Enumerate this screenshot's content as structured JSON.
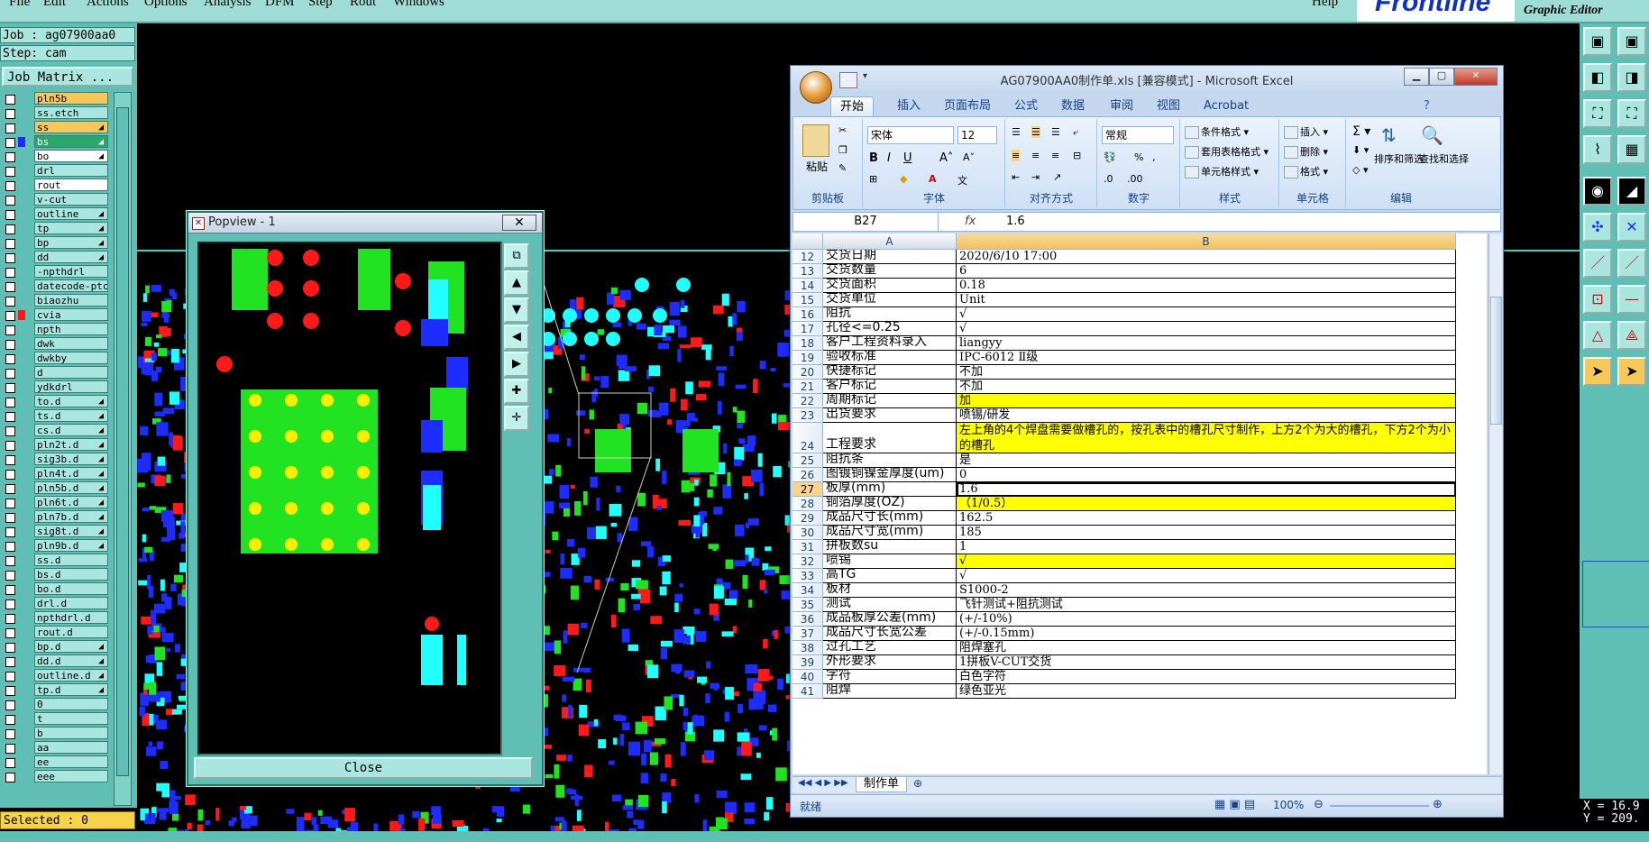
{
  "menubar": {
    "items": [
      "File",
      "Edit",
      "Actions",
      "Options",
      "Analysis",
      "DFM",
      "Step",
      "Rout",
      "Windows"
    ],
    "help": "Help",
    "logo": "Frontline",
    "product": "Graphic Editor"
  },
  "job": {
    "job_label": "Job : ag07900aa0",
    "step_label": "Step: cam",
    "matrix_button": "Job Matrix ..."
  },
  "layers": [
    {
      "name": "pln5b",
      "color": "#f6c85a",
      "flag": ""
    },
    {
      "name": "ss.etch",
      "color": "#a8e6df",
      "flag": ""
    },
    {
      "name": "ss",
      "color": "#f6c85a",
      "flag": "◢"
    },
    {
      "name": "bs",
      "color": "#2aa86c",
      "flag": "◢"
    },
    {
      "name": "bo",
      "color": "#ffffff",
      "flag": "◢"
    },
    {
      "name": "drl",
      "color": "#a8e6df",
      "flag": ""
    },
    {
      "name": "rout",
      "color": "#ffffff",
      "flag": ""
    },
    {
      "name": "v-cut",
      "color": "#a8e6df",
      "flag": ""
    },
    {
      "name": "outline",
      "color": "#a8e6df",
      "flag": "◢"
    },
    {
      "name": "tp",
      "color": "#a8e6df",
      "flag": "◢"
    },
    {
      "name": "bp",
      "color": "#a8e6df",
      "flag": "◢"
    },
    {
      "name": "dd",
      "color": "#a8e6df",
      "flag": "◢"
    },
    {
      "name": "-npthdrl",
      "color": "#a8e6df",
      "flag": ""
    },
    {
      "name": "datecode-ptc",
      "color": "#a8e6df",
      "flag": ""
    },
    {
      "name": "biaozhu",
      "color": "#a8e6df",
      "flag": ""
    },
    {
      "name": "cvia",
      "color": "#a8e6df",
      "flag": ""
    },
    {
      "name": "npth",
      "color": "#a8e6df",
      "flag": ""
    },
    {
      "name": "dwk",
      "color": "#a8e6df",
      "flag": ""
    },
    {
      "name": "dwkby",
      "color": "#a8e6df",
      "flag": ""
    },
    {
      "name": "d",
      "color": "#a8e6df",
      "flag": ""
    },
    {
      "name": "ydkdrl",
      "color": "#a8e6df",
      "flag": ""
    },
    {
      "name": "to.d",
      "color": "#a8e6df",
      "flag": "◢"
    },
    {
      "name": "ts.d",
      "color": "#a8e6df",
      "flag": "◢"
    },
    {
      "name": "cs.d",
      "color": "#a8e6df",
      "flag": "◢"
    },
    {
      "name": "pln2t.d",
      "color": "#a8e6df",
      "flag": "◢"
    },
    {
      "name": "sig3b.d",
      "color": "#a8e6df",
      "flag": "◢"
    },
    {
      "name": "pln4t.d",
      "color": "#a8e6df",
      "flag": "◢"
    },
    {
      "name": "pln5b.d",
      "color": "#a8e6df",
      "flag": "◢"
    },
    {
      "name": "pln6t.d",
      "color": "#a8e6df",
      "flag": "◢"
    },
    {
      "name": "pln7b.d",
      "color": "#a8e6df",
      "flag": "◢"
    },
    {
      "name": "sig8t.d",
      "color": "#a8e6df",
      "flag": "◢"
    },
    {
      "name": "pln9b.d",
      "color": "#a8e6df",
      "flag": "◢"
    },
    {
      "name": "ss.d",
      "color": "#a8e6df",
      "flag": ""
    },
    {
      "name": "bs.d",
      "color": "#a8e6df",
      "flag": ""
    },
    {
      "name": "bo.d",
      "color": "#a8e6df",
      "flag": ""
    },
    {
      "name": "drl.d",
      "color": "#a8e6df",
      "flag": ""
    },
    {
      "name": "npthdrl.d",
      "color": "#a8e6df",
      "flag": ""
    },
    {
      "name": "rout.d",
      "color": "#a8e6df",
      "flag": ""
    },
    {
      "name": "bp.d",
      "color": "#a8e6df",
      "flag": "◢"
    },
    {
      "name": "dd.d",
      "color": "#a8e6df",
      "flag": "◢"
    },
    {
      "name": "outline.d",
      "color": "#a8e6df",
      "flag": "◢"
    },
    {
      "name": "tp.d",
      "color": "#a8e6df",
      "flag": "◢"
    },
    {
      "name": "0",
      "color": "#a8e6df",
      "flag": ""
    },
    {
      "name": "t",
      "color": "#a8e6df",
      "flag": ""
    },
    {
      "name": "b",
      "color": "#a8e6df",
      "flag": ""
    },
    {
      "name": "aa",
      "color": "#a8e6df",
      "flag": ""
    },
    {
      "name": "ee",
      "color": "#a8e6df",
      "flag": ""
    },
    {
      "name": "eee",
      "color": "#a8e6df",
      "flag": ""
    }
  ],
  "selected_label": "Selected : 0",
  "popview": {
    "title": "Popview - 1",
    "close_x": "✕",
    "close_button": "Close"
  },
  "excel": {
    "title": "AG07900AA0制作单.xls  [兼容模式] - Microsoft Excel",
    "tabs": [
      "开始",
      "插入",
      "页面布局",
      "公式",
      "数据",
      "审阅",
      "视图",
      "Acrobat"
    ],
    "ribbon": {
      "paste": "粘贴",
      "clipboard": "剪贴板",
      "font_name": "宋体",
      "font_size": "12",
      "font_group": "字体",
      "align_group": "对齐方式",
      "number_format": "常规",
      "number_group": "数字",
      "cond_format": "条件格式",
      "table_format": "套用表格格式",
      "cell_style": "单元格样式",
      "style_group": "样式",
      "insert": "插入",
      "delete": "删除",
      "format": "格式",
      "cells_group": "单元格",
      "sort_filter": "排序和筛选",
      "find_select": "查找和选择",
      "edit_group": "编辑"
    },
    "name_box": "B27",
    "fx": "fx",
    "formula_value": "1.6",
    "col_a": "A",
    "col_b": "B",
    "rows": [
      {
        "n": "12",
        "a": "交货日期",
        "b": "2020/6/10 17:00",
        "hl": false,
        "h": 16
      },
      {
        "n": "13",
        "a": "交货数量",
        "b": "6",
        "hl": false,
        "h": 16
      },
      {
        "n": "14",
        "a": "交货面积",
        "b": "0.18",
        "hl": false,
        "h": 16
      },
      {
        "n": "15",
        "a": "交货单位",
        "b": "Unit",
        "hl": false,
        "h": 16
      },
      {
        "n": "16",
        "a": "阻抗",
        "b": "√",
        "hl": false,
        "h": 16
      },
      {
        "n": "17",
        "a": "孔径<=0.25",
        "b": "√",
        "hl": false,
        "h": 16
      },
      {
        "n": "18",
        "a": "客户工程资料录入",
        "b": "liangyy",
        "hl": false,
        "h": 16
      },
      {
        "n": "19",
        "a": "验收标准",
        "b": "IPC-6012 Ⅱ级",
        "hl": false,
        "h": 16
      },
      {
        "n": "20",
        "a": "快捷标记",
        "b": "不加",
        "hl": false,
        "h": 16
      },
      {
        "n": "21",
        "a": "客户标记",
        "b": "不加",
        "hl": false,
        "h": 16
      },
      {
        "n": "22",
        "a": "周期标记",
        "b": "加",
        "hl": true,
        "h": 16
      },
      {
        "n": "23",
        "a": "出货要求",
        "b": "喷锡/研发",
        "hl": false,
        "h": 16
      },
      {
        "n": "24",
        "a": "工程要求",
        "b": "左上角的4个焊盘需要做槽孔的，按孔表中的槽孔尺寸制作，上方2个为大的槽孔，下方2个为小的槽孔",
        "hl": true,
        "h": 34,
        "wrap": true
      },
      {
        "n": "25",
        "a": "阻抗条",
        "b": "是",
        "hl": false,
        "h": 16
      },
      {
        "n": "26",
        "a": "图镀铜镍金厚度(um)",
        "b": "0",
        "hl": false,
        "h": 16
      },
      {
        "n": "27",
        "a": "板厚(mm)",
        "b": "1.6",
        "hl": false,
        "h": 16,
        "active": true
      },
      {
        "n": "28",
        "a": "铜箔厚度(OZ)",
        "b": "（1/0.5）",
        "hl": true,
        "h": 16
      },
      {
        "n": "29",
        "a": "成品尺寸长(mm)",
        "b": "162.5",
        "hl": false,
        "h": 16
      },
      {
        "n": "30",
        "a": "成品尺寸宽(mm)",
        "b": "185",
        "hl": false,
        "h": 16
      },
      {
        "n": "31",
        "a": "拼板数su",
        "b": "1",
        "hl": false,
        "h": 16
      },
      {
        "n": "32",
        "a": "喷锡",
        "b": "√",
        "hl": true,
        "h": 16
      },
      {
        "n": "33",
        "a": "高TG",
        "b": "√",
        "hl": false,
        "h": 16
      },
      {
        "n": "34",
        "a": "板材",
        "b": "S1000-2",
        "hl": false,
        "h": 16
      },
      {
        "n": "35",
        "a": "测试",
        "b": "飞针测试+阻抗测试",
        "hl": false,
        "h": 16
      },
      {
        "n": "36",
        "a": "成品板厚公差(mm)",
        "b": "(+/-10%)",
        "hl": false,
        "h": 16
      },
      {
        "n": "37",
        "a": "成品尺寸长宽公差",
        "b": "(+/-0.15mm)",
        "hl": false,
        "h": 16
      },
      {
        "n": "38",
        "a": "过孔工艺",
        "b": "阻焊塞孔",
        "hl": false,
        "h": 16
      },
      {
        "n": "39",
        "a": "外形要求",
        "b": "1拼板V-CUT交货",
        "hl": false,
        "h": 16
      },
      {
        "n": "40",
        "a": "字符",
        "b": "白色字符",
        "hl": false,
        "h": 16
      },
      {
        "n": "41",
        "a": "阻焊",
        "b": "绿色亚光",
        "hl": false,
        "h": 16
      }
    ],
    "sheet_tab": "制作单",
    "status_ready": "就绪",
    "zoom": "100%"
  },
  "coords": {
    "x": "X = 16.9",
    "y": "Y = 209."
  }
}
